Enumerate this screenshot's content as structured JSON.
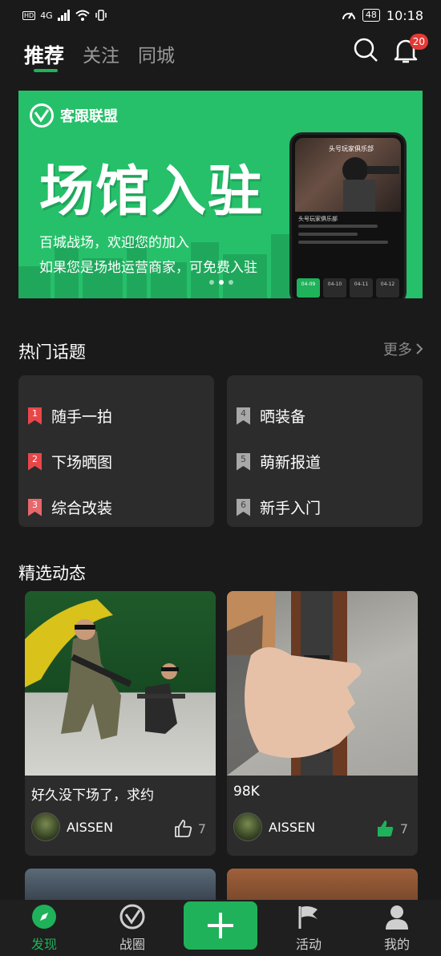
{
  "status_bar": {
    "network": "4G",
    "battery": "48",
    "time": "10:18"
  },
  "top_nav": {
    "tabs": [
      "推荐",
      "关注",
      "同城"
    ],
    "active_tab": "推荐",
    "notification_count": "20"
  },
  "banner": {
    "brand": "客跟联盟",
    "headline": "场馆入驻",
    "line1": "百城战场，欢迎您的加入",
    "line2": "如果您是场地运营商家，可免费入驻",
    "phone_title": "头号玩家俱乐部",
    "phone_name": "头号玩家俱乐部",
    "phone_dates": [
      "04-09",
      "04-10",
      "04-11",
      "04-12"
    ],
    "page_count": 3,
    "active_page": 2
  },
  "hot_topics": {
    "title": "热门话题",
    "more_label": "更多",
    "items": [
      {
        "rank": "1",
        "label": "随手一拍"
      },
      {
        "rank": "2",
        "label": "下场晒图"
      },
      {
        "rank": "3",
        "label": "综合改装"
      },
      {
        "rank": "4",
        "label": "晒装备"
      },
      {
        "rank": "5",
        "label": "萌新报道"
      },
      {
        "rank": "6",
        "label": "新手入门"
      }
    ]
  },
  "featured": {
    "title": "精选动态",
    "posts": [
      {
        "text": "好久没下场了，求约",
        "user": "AISSEN",
        "likes": "7",
        "liked": false
      },
      {
        "text": "98K",
        "user": "AISSEN",
        "likes": "7",
        "liked": true
      }
    ]
  },
  "bottom_nav": {
    "items": [
      "发现",
      "战圈",
      "活动",
      "我的"
    ],
    "active": "发现"
  },
  "colors": {
    "accent": "#1fb25a",
    "background": "#1a1a1a",
    "card": "#2c2c2c",
    "badge": "#e53935"
  }
}
